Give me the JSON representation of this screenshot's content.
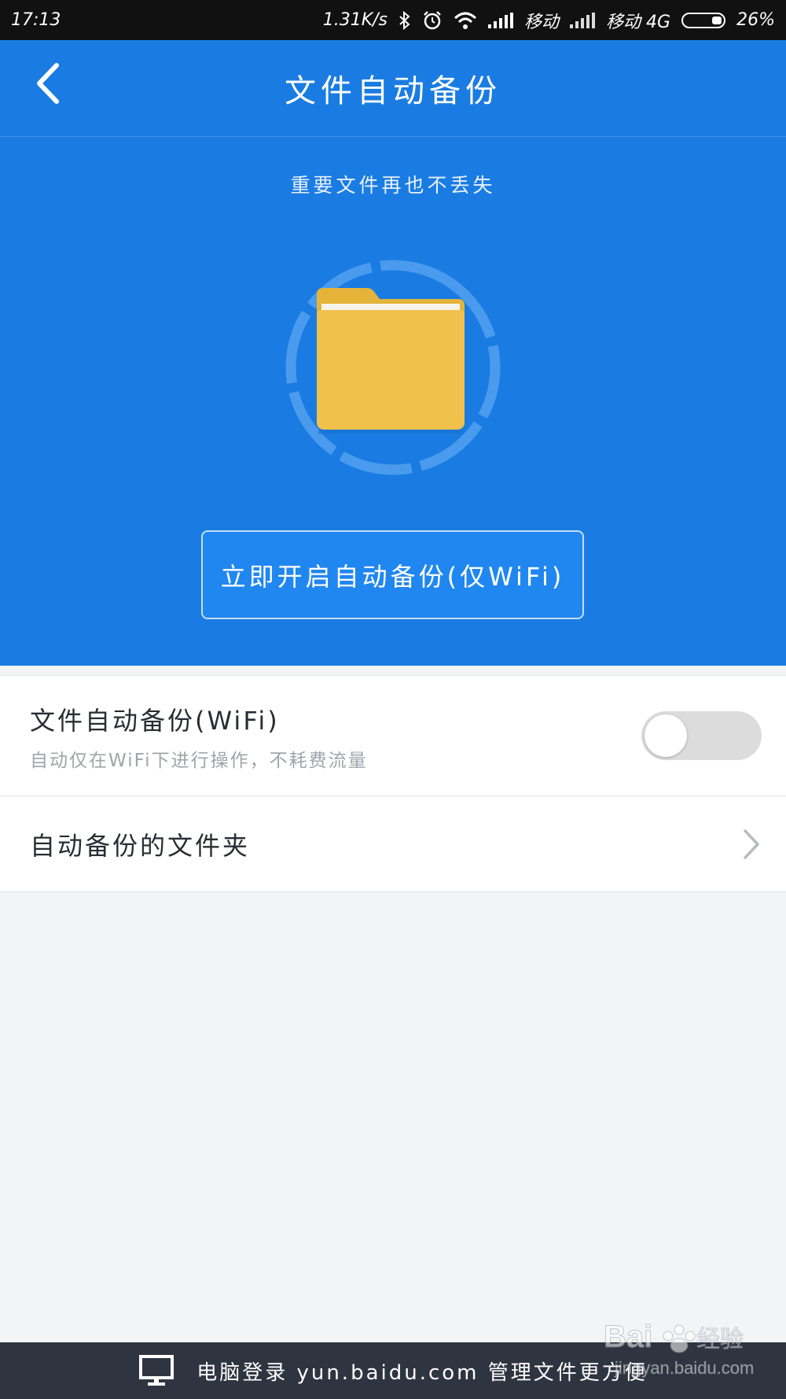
{
  "status_bar": {
    "time": "17:13",
    "speed": "1.31K/s",
    "carrier1": "移动",
    "carrier2": "移动 4G",
    "battery": "26%",
    "icons": [
      "bluetooth-icon",
      "alarm-icon",
      "wifi-icon",
      "signal-icon",
      "battery-icon"
    ]
  },
  "header": {
    "title": "文件自动备份",
    "back_icon": "chevron-left-icon"
  },
  "hero": {
    "subtitle": "重要文件再也不丢失",
    "illustration": "folder-icon",
    "button_label": "立即开启自动备份(仅WiFi)"
  },
  "settings": {
    "wifi_backup": {
      "title": "文件自动备份(WiFi)",
      "description": "自动仅在WiFi下进行操作，不耗费流量",
      "enabled": false
    },
    "backup_folders": {
      "title": "自动备份的文件夹"
    }
  },
  "bottom_bar": {
    "text": "电脑登录 yun.baidu.com 管理文件更方便",
    "icon": "monitor-icon"
  },
  "watermark": {
    "brand": "Bai 经验",
    "url": "jingyan.baidu.com"
  },
  "colors": {
    "primary": "#1a7ce2",
    "folder": "#f0c14b",
    "bottom_bar": "#2f3540"
  }
}
